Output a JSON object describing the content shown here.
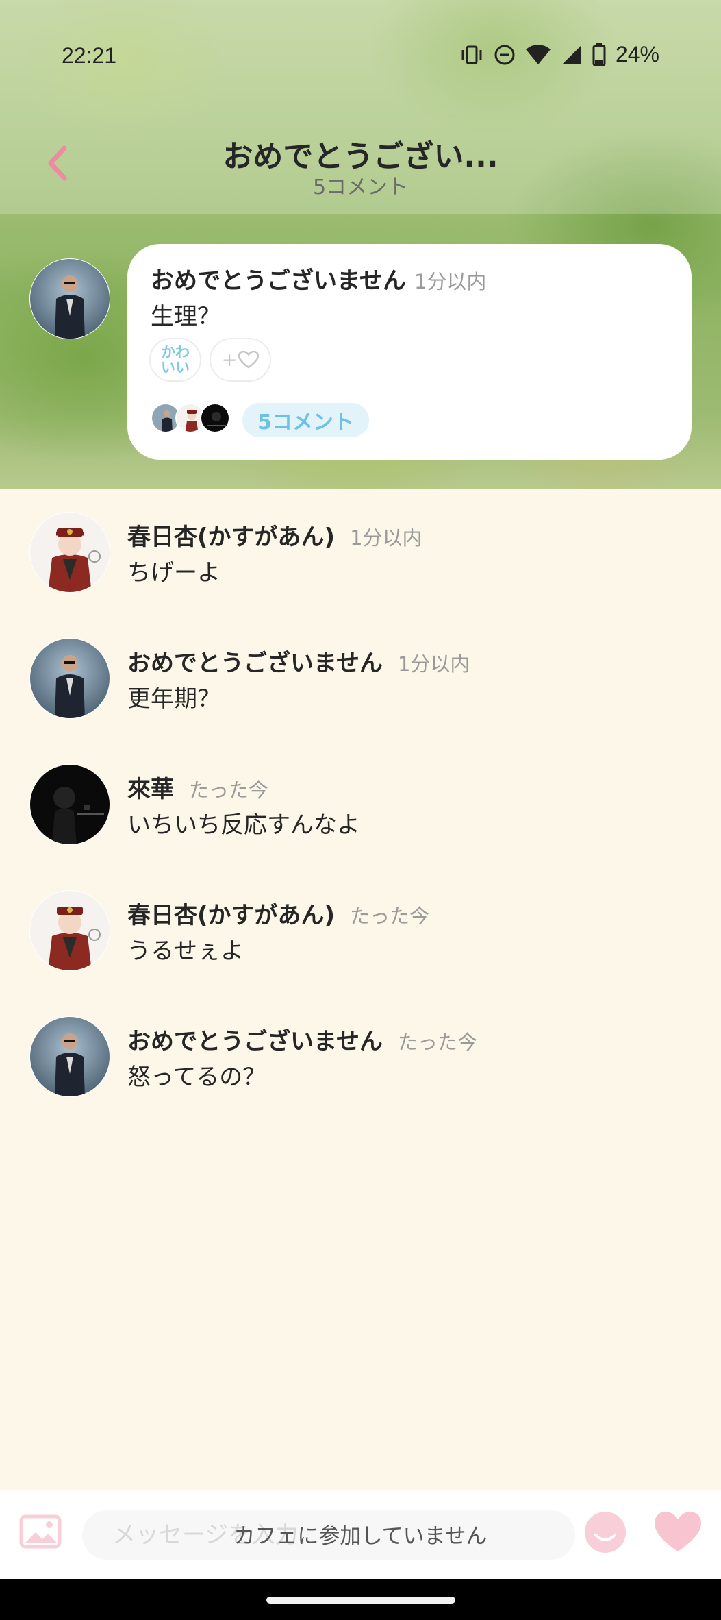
{
  "status_bar": {
    "time": "22:21",
    "battery": "24%",
    "icons": [
      "vibrate-icon",
      "dnd-icon",
      "wifi-icon",
      "signal-icon",
      "battery-icon"
    ]
  },
  "header": {
    "title": "おめでとうござい...",
    "subtitle": "5コメント",
    "accent_color": "#f08aa0"
  },
  "post": {
    "author": "おめでとうございません",
    "time": "1分以内",
    "body": "生理？",
    "reaction_label": "かわいい",
    "add_reaction_label": "+",
    "comment_count_label": "5コメント"
  },
  "comments": [
    {
      "author": "春日杏(かすがあん)",
      "time": "1分以内",
      "text": "ちげーよ",
      "avatar": "anime-avatar"
    },
    {
      "author": "おめでとうございません",
      "time": "1分以内",
      "text": "更年期？",
      "avatar": "suit-avatar"
    },
    {
      "author": "來華",
      "time": "たった今",
      "text": "いちいち反応すんなよ",
      "avatar": "dark-avatar"
    },
    {
      "author": "春日杏(かすがあん)",
      "time": "たった今",
      "text": "うるせぇよ",
      "avatar": "anime-avatar"
    },
    {
      "author": "おめでとうございません",
      "time": "たった今",
      "text": "怒ってるの？",
      "avatar": "suit-avatar"
    }
  ],
  "input_bar": {
    "placeholder": "メッセージを入力",
    "overlay_notice": "カフェに参加していません"
  }
}
